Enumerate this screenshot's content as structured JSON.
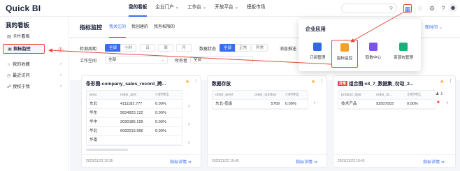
{
  "header": {
    "logo": "Quick BI",
    "nav": [
      "我的看板",
      "企业门户",
      "工作台",
      "开放平台",
      "模板市场"
    ],
    "nav_carets": [
      "",
      "⌄",
      "⌄",
      "⌄",
      ""
    ]
  },
  "sidebar": {
    "title": "我的看板",
    "items": [
      {
        "label": "卡片看板"
      },
      {
        "label": "指标监控",
        "count": "1"
      },
      {
        "label": "我的收藏"
      },
      {
        "label": "最近访问"
      },
      {
        "label": "授权于我"
      }
    ]
  },
  "main": {
    "page_title": "指标监控",
    "tabs": [
      "我关注的",
      "我创建的",
      "我有权限的"
    ],
    "time_dropdown": "新时间",
    "filters": {
      "period_label": "检测周期",
      "period_options": [
        "全部",
        "小时",
        "日",
        "周",
        "月"
      ],
      "status_label": "数据状态",
      "status_options": [
        "全部",
        "正常",
        "异常"
      ],
      "push_label": "消息推送",
      "workspace_label": "工作空间",
      "workspace_value": "全部",
      "owner_label": "所有者",
      "owner_value": "全部"
    },
    "cards": [
      {
        "title": "条形图-company_sales_record_跨...",
        "columns": [
          "area",
          "order_amt",
          "小时环比"
        ],
        "rows": [
          [
            "东北",
            "4111182.777",
            "0.00%"
          ],
          [
            "华东",
            "5834923.122",
            "0.00%"
          ],
          [
            "华中",
            "2090186.159",
            "0.00%"
          ],
          [
            "华北",
            "6060219.966",
            "0.00%"
          ],
          [
            "华南",
            "",
            ""
          ]
        ],
        "date": "2023/11/22 10:35",
        "link": "指标详情"
      },
      {
        "title": "数据存放",
        "columns": [
          "order_level",
          "order_number",
          "小时环比"
        ],
        "rows": [
          [
            "东北-低级",
            "5769",
            "0.00%"
          ]
        ],
        "date": "2023/11/22 10:45",
        "link": "指标详情"
      },
      {
        "tag": "异常",
        "title": "组合图-v4_7_数据集_勿动_2...",
        "columns": [
          "product_type",
          "order_st...",
          "小时环比"
        ],
        "rows": [
          [
            "技术产品",
            "92507003",
            "0.00%"
          ]
        ],
        "row_right": "1",
        "date": "2023/11/22 10:45",
        "link": "指标详情"
      }
    ]
  },
  "popup": {
    "title": "企业应用",
    "apps": [
      {
        "label": "订阅管理",
        "color": "#2f6bdc"
      },
      {
        "label": "指标监控",
        "color": "#f0a12b"
      },
      {
        "label": "取数中心",
        "color": "#7c55e6"
      },
      {
        "label": "资源包管理",
        "color": "#19b07a"
      }
    ]
  },
  "colors": {
    "accent": "#3a6cf0",
    "highlight": "#e34b3c",
    "star": "#f5a623"
  }
}
